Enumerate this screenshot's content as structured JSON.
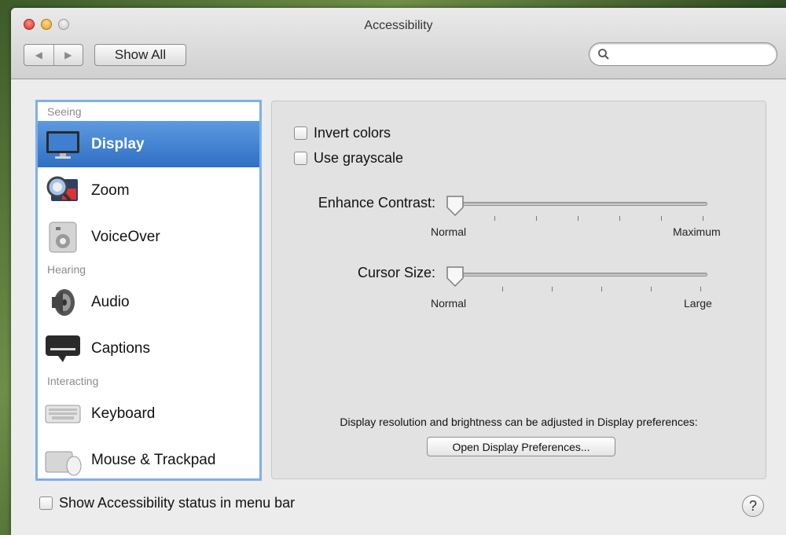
{
  "window": {
    "title": "Accessibility"
  },
  "toolbar": {
    "back_glyph": "◀",
    "forward_glyph": "▶",
    "show_all_label": "Show All",
    "search_placeholder": "",
    "search_value": ""
  },
  "sidebar": {
    "sections": [
      {
        "label": "Seeing",
        "items": [
          {
            "label": "Display",
            "icon": "display-icon",
            "selected": true
          },
          {
            "label": "Zoom",
            "icon": "zoom-icon",
            "selected": false
          },
          {
            "label": "VoiceOver",
            "icon": "voiceover-icon",
            "selected": false
          }
        ]
      },
      {
        "label": "Hearing",
        "items": [
          {
            "label": "Audio",
            "icon": "speaker-icon",
            "selected": false
          },
          {
            "label": "Captions",
            "icon": "captions-icon",
            "selected": false
          }
        ]
      },
      {
        "label": "Interacting",
        "items": [
          {
            "label": "Keyboard",
            "icon": "keyboard-icon",
            "selected": false
          },
          {
            "label": "Mouse & Trackpad",
            "icon": "mouse-icon",
            "selected": false
          }
        ]
      }
    ]
  },
  "display_panel": {
    "invert_colors": {
      "label": "Invert colors",
      "checked": false
    },
    "use_grayscale": {
      "label": "Use grayscale",
      "checked": false
    },
    "enhance_contrast": {
      "label": "Enhance Contrast:",
      "min_label": "Normal",
      "max_label": "Maximum",
      "value": 0,
      "ticks": 7
    },
    "cursor_size": {
      "label": "Cursor Size:",
      "min_label": "Normal",
      "max_label": "Large",
      "value": 0,
      "ticks": 6
    },
    "note": "Display resolution and brightness can be adjusted in Display preferences:",
    "open_display_prefs_label": "Open Display Preferences..."
  },
  "footer": {
    "status_checkbox_label": "Show Accessibility status in menu bar",
    "status_checked": false,
    "help_glyph": "?"
  },
  "colors": {
    "selection": "#3a7bd0",
    "sidebar_border": "#7fb0e8"
  }
}
